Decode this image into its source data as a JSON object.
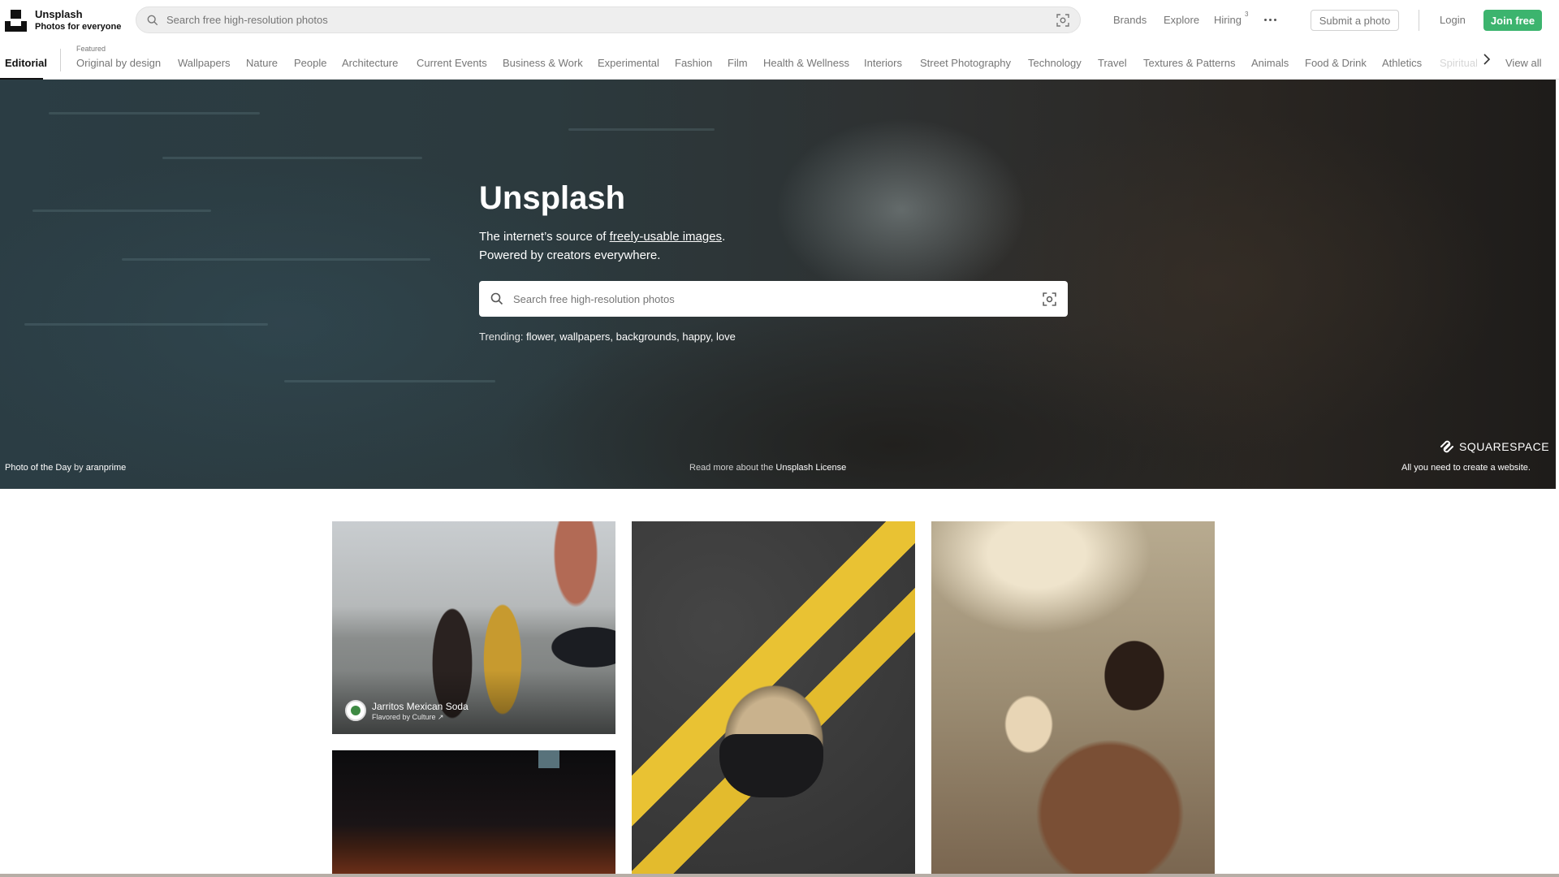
{
  "header": {
    "brand_name": "Unsplash",
    "brand_tagline": "Photos for everyone",
    "search_placeholder": "Search free high-resolution photos",
    "nav": {
      "brands": "Brands",
      "explore": "Explore",
      "hiring": "Hiring",
      "hiring_badge": "3"
    },
    "submit_label": "Submit a photo",
    "login_label": "Login",
    "join_label": "Join free"
  },
  "topics": {
    "active": "Editorial",
    "featured_label": "Featured",
    "items": [
      "Original by design",
      "Wallpapers",
      "Nature",
      "People",
      "Architecture",
      "Current Events",
      "Business & Work",
      "Experimental",
      "Fashion",
      "Film",
      "Health & Wellness",
      "Interiors",
      "Street Photography",
      "Technology",
      "Travel",
      "Textures & Patterns",
      "Animals",
      "Food & Drink",
      "Athletics"
    ],
    "faded": "Spirituality",
    "view_all": "View all"
  },
  "hero": {
    "title": "Unsplash",
    "sub_prefix": "The internet’s source of ",
    "sub_link": "freely-usable images",
    "sub_suffix": ".",
    "sub_line2": "Powered by creators everywhere.",
    "search_placeholder": "Search free high-resolution photos",
    "trending_label": "Trending:",
    "trending": [
      "flower",
      "wallpapers",
      "backgrounds",
      "happy",
      "love"
    ],
    "potd_prefix": "Photo of the Day",
    "potd_by": "by",
    "potd_author": "aranprime",
    "license_prefix": "Read more about the",
    "license_link": "Unsplash License",
    "sponsor_name": "SQUARESPACE",
    "sponsor_tagline": "All you need to create a website."
  },
  "grid": {
    "sponsored_name": "Jarritos Mexican Soda",
    "sponsored_sub": "Flavored by Culture ↗"
  },
  "colors": {
    "accent_green": "#3cb46e",
    "text_muted": "#767676"
  }
}
